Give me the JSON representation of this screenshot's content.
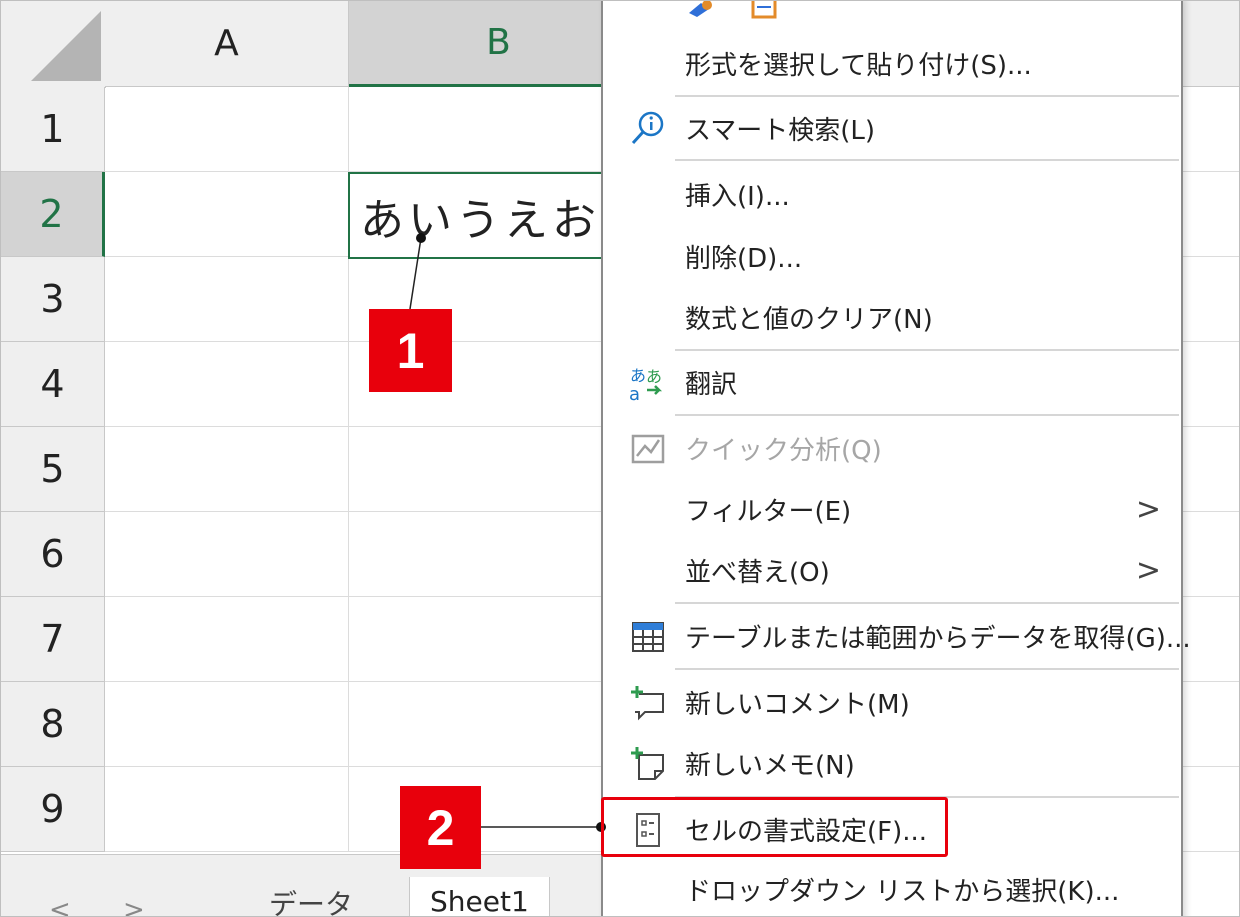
{
  "columns": [
    "A",
    "B"
  ],
  "rows": [
    "1",
    "2",
    "3",
    "4",
    "5",
    "6",
    "7",
    "8",
    "9"
  ],
  "active_cell": {
    "value": "あいうえお"
  },
  "sheet_tabs": {
    "nav_prev": "<",
    "nav_next": ">",
    "tabs": [
      "データ",
      "Sheet1"
    ]
  },
  "context_menu": {
    "items": [
      {
        "label": "形式を選択して貼り付け(S)...",
        "icon": "none"
      },
      {
        "label": "スマート検索(L)",
        "icon": "smart-lookup-icon"
      },
      {
        "label": "挿入(I)...",
        "icon": "none"
      },
      {
        "label": "削除(D)...",
        "icon": "none"
      },
      {
        "label": "数式と値のクリア(N)",
        "icon": "none"
      },
      {
        "label": "翻訳",
        "icon": "translate-icon"
      },
      {
        "label": "クイック分析(Q)",
        "icon": "quick-analysis-icon",
        "disabled": true
      },
      {
        "label": "フィルター(E)",
        "icon": "none",
        "submenu": ">"
      },
      {
        "label": "並べ替え(O)",
        "icon": "none",
        "submenu": ">"
      },
      {
        "label": "テーブルまたは範囲からデータを取得(G)...",
        "icon": "table-icon"
      },
      {
        "label": "新しいコメント(M)",
        "icon": "new-comment-icon"
      },
      {
        "label": "新しいメモ(N)",
        "icon": "new-note-icon"
      },
      {
        "label": "セルの書式設定(F)...",
        "icon": "format-cells-icon"
      },
      {
        "label": "ドロップダウン リストから選択(K)...",
        "icon": "none"
      }
    ]
  },
  "callouts": [
    "1",
    "2"
  ],
  "colors": {
    "accent_green": "#217346",
    "callout_red": "#e8000c"
  }
}
